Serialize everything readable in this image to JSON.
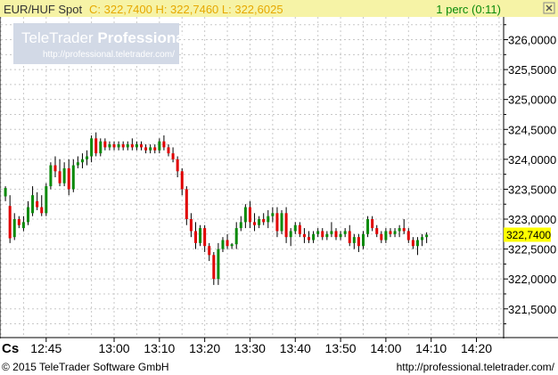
{
  "header": {
    "symbol": "EUR/HUF Spot",
    "quote": "C: 322,7400 H: 322,7460 L: 322,6025",
    "interval": "1 perc (0:11)"
  },
  "watermark": {
    "brand_light": "TeleTrader ",
    "brand_bold": "Professional",
    "url": "http://professional.teletrader.com/"
  },
  "footer": {
    "copyright": "© 2015 TeleTrader Software GmbH",
    "url": "http://professional.teletrader.com/"
  },
  "x_axis_corner": "Cs",
  "colors": {
    "up": "#0a8a0a",
    "down": "#e00000",
    "header_bg": "#f6f3a6",
    "last_price_badge": "#ffff00",
    "grid": "#c8c8c8"
  },
  "chart_data": {
    "type": "candlestick",
    "x_unit": "time (HH:MM)",
    "x_ticks": [
      "12:45",
      "13:00",
      "13:10",
      "13:20",
      "13:30",
      "13:40",
      "13:50",
      "14:00",
      "14:10",
      "14:20"
    ],
    "xlim": [
      "12:35",
      "14:26"
    ],
    "y_ticks": [
      "326,0000",
      "325,5000",
      "325,0000",
      "324,5000",
      "324,0000",
      "323,5000",
      "323,0000",
      "322,5000",
      "322,0000",
      "321,5000"
    ],
    "ylim": [
      321.02,
      326.38
    ],
    "last_price": 322.74,
    "last_price_label": "322,7400",
    "grid": true,
    "candles": [
      {
        "t": "12:36",
        "o": 323.38,
        "h": 323.55,
        "l": 323.3,
        "c": 323.52
      },
      {
        "t": "12:37",
        "o": 323.22,
        "h": 323.4,
        "l": 322.6,
        "c": 322.68
      },
      {
        "t": "12:38",
        "o": 322.7,
        "h": 323.1,
        "l": 322.65,
        "c": 323.0
      },
      {
        "t": "12:39",
        "o": 323.0,
        "h": 323.05,
        "l": 322.85,
        "c": 322.9
      },
      {
        "t": "12:40",
        "o": 322.85,
        "h": 323.05,
        "l": 322.8,
        "c": 322.95
      },
      {
        "t": "12:41",
        "o": 322.95,
        "h": 323.3,
        "l": 322.9,
        "c": 323.2
      },
      {
        "t": "12:42",
        "o": 323.1,
        "h": 323.55,
        "l": 323.05,
        "c": 323.4
      },
      {
        "t": "12:43",
        "o": 323.3,
        "h": 323.45,
        "l": 323.15,
        "c": 323.2
      },
      {
        "t": "12:44",
        "o": 323.2,
        "h": 323.4,
        "l": 323.05,
        "c": 323.1
      },
      {
        "t": "12:45",
        "o": 323.1,
        "h": 323.6,
        "l": 323.05,
        "c": 323.55
      },
      {
        "t": "12:46",
        "o": 323.55,
        "h": 323.95,
        "l": 323.5,
        "c": 323.9
      },
      {
        "t": "12:47",
        "o": 323.9,
        "h": 324.05,
        "l": 323.7,
        "c": 323.8
      },
      {
        "t": "12:48",
        "o": 323.8,
        "h": 324.0,
        "l": 323.55,
        "c": 323.6
      },
      {
        "t": "12:49",
        "o": 323.6,
        "h": 323.95,
        "l": 323.55,
        "c": 323.85
      },
      {
        "t": "12:50",
        "o": 323.85,
        "h": 324.0,
        "l": 323.4,
        "c": 323.5
      },
      {
        "t": "12:51",
        "o": 323.5,
        "h": 324.0,
        "l": 323.45,
        "c": 323.9
      },
      {
        "t": "12:52",
        "o": 323.9,
        "h": 324.05,
        "l": 323.85,
        "c": 323.95
      },
      {
        "t": "12:53",
        "o": 323.95,
        "h": 324.1,
        "l": 323.85,
        "c": 324.0
      },
      {
        "t": "12:54",
        "o": 324.0,
        "h": 324.15,
        "l": 323.9,
        "c": 324.05
      },
      {
        "t": "12:55",
        "o": 324.05,
        "h": 324.4,
        "l": 323.95,
        "c": 324.35
      },
      {
        "t": "12:56",
        "o": 324.35,
        "h": 324.45,
        "l": 324.05,
        "c": 324.1
      },
      {
        "t": "12:57",
        "o": 324.1,
        "h": 324.35,
        "l": 324.05,
        "c": 324.3
      },
      {
        "t": "12:58",
        "o": 324.3,
        "h": 324.35,
        "l": 324.15,
        "c": 324.2
      },
      {
        "t": "12:59",
        "o": 324.2,
        "h": 324.3,
        "l": 324.15,
        "c": 324.25
      },
      {
        "t": "13:00",
        "o": 324.25,
        "h": 324.3,
        "l": 324.15,
        "c": 324.2
      },
      {
        "t": "13:01",
        "o": 324.2,
        "h": 324.3,
        "l": 324.15,
        "c": 324.25
      },
      {
        "t": "13:02",
        "o": 324.25,
        "h": 324.3,
        "l": 324.15,
        "c": 324.2
      },
      {
        "t": "13:03",
        "o": 324.2,
        "h": 324.3,
        "l": 324.15,
        "c": 324.25
      },
      {
        "t": "13:04",
        "o": 324.25,
        "h": 324.35,
        "l": 324.15,
        "c": 324.2
      },
      {
        "t": "13:05",
        "o": 324.2,
        "h": 324.3,
        "l": 324.15,
        "c": 324.25
      },
      {
        "t": "13:06",
        "o": 324.25,
        "h": 324.3,
        "l": 324.15,
        "c": 324.2
      },
      {
        "t": "13:07",
        "o": 324.2,
        "h": 324.25,
        "l": 324.1,
        "c": 324.15
      },
      {
        "t": "13:08",
        "o": 324.15,
        "h": 324.25,
        "l": 324.1,
        "c": 324.2
      },
      {
        "t": "13:09",
        "o": 324.2,
        "h": 324.25,
        "l": 324.1,
        "c": 324.15
      },
      {
        "t": "13:10",
        "o": 324.15,
        "h": 324.35,
        "l": 324.1,
        "c": 324.3
      },
      {
        "t": "13:11",
        "o": 324.3,
        "h": 324.4,
        "l": 324.15,
        "c": 324.2
      },
      {
        "t": "13:12",
        "o": 324.2,
        "h": 324.25,
        "l": 324.05,
        "c": 324.1
      },
      {
        "t": "13:13",
        "o": 324.1,
        "h": 324.2,
        "l": 323.95,
        "c": 324.0
      },
      {
        "t": "13:14",
        "o": 324.0,
        "h": 324.05,
        "l": 323.7,
        "c": 323.8
      },
      {
        "t": "13:15",
        "o": 323.8,
        "h": 323.85,
        "l": 323.4,
        "c": 323.5
      },
      {
        "t": "13:16",
        "o": 323.5,
        "h": 323.55,
        "l": 322.9,
        "c": 323.0
      },
      {
        "t": "13:17",
        "o": 323.0,
        "h": 323.1,
        "l": 322.7,
        "c": 322.8
      },
      {
        "t": "13:18",
        "o": 322.8,
        "h": 322.95,
        "l": 322.5,
        "c": 322.6
      },
      {
        "t": "13:19",
        "o": 322.6,
        "h": 322.9,
        "l": 322.55,
        "c": 322.85
      },
      {
        "t": "13:20",
        "o": 322.85,
        "h": 322.9,
        "l": 322.45,
        "c": 322.55
      },
      {
        "t": "13:21",
        "o": 322.55,
        "h": 322.6,
        "l": 322.3,
        "c": 322.4
      },
      {
        "t": "13:22",
        "o": 322.4,
        "h": 322.45,
        "l": 321.9,
        "c": 322.0
      },
      {
        "t": "13:23",
        "o": 322.0,
        "h": 322.6,
        "l": 321.9,
        "c": 322.5
      },
      {
        "t": "13:24",
        "o": 322.5,
        "h": 322.7,
        "l": 322.45,
        "c": 322.65
      },
      {
        "t": "13:25",
        "o": 322.65,
        "h": 322.75,
        "l": 322.5,
        "c": 322.55
      },
      {
        "t": "13:26",
        "o": 322.55,
        "h": 322.6,
        "l": 322.5,
        "c": 322.58
      },
      {
        "t": "13:27",
        "o": 322.58,
        "h": 322.95,
        "l": 322.5,
        "c": 322.85
      },
      {
        "t": "13:28",
        "o": 322.85,
        "h": 323.05,
        "l": 322.8,
        "c": 322.95
      },
      {
        "t": "13:29",
        "o": 322.95,
        "h": 323.25,
        "l": 322.85,
        "c": 323.2
      },
      {
        "t": "13:30",
        "o": 323.2,
        "h": 323.3,
        "l": 322.85,
        "c": 322.95
      },
      {
        "t": "13:31",
        "o": 322.95,
        "h": 323.1,
        "l": 322.8,
        "c": 322.9
      },
      {
        "t": "13:32",
        "o": 322.9,
        "h": 323.05,
        "l": 322.85,
        "c": 323.0
      },
      {
        "t": "13:33",
        "o": 323.0,
        "h": 323.1,
        "l": 322.9,
        "c": 322.95
      },
      {
        "t": "13:34",
        "o": 322.95,
        "h": 323.15,
        "l": 322.85,
        "c": 323.05
      },
      {
        "t": "13:35",
        "o": 323.05,
        "h": 323.2,
        "l": 322.95,
        "c": 323.1
      },
      {
        "t": "13:36",
        "o": 323.1,
        "h": 323.2,
        "l": 322.7,
        "c": 322.8
      },
      {
        "t": "13:37",
        "o": 322.8,
        "h": 323.15,
        "l": 322.75,
        "c": 323.1
      },
      {
        "t": "13:38",
        "o": 323.1,
        "h": 323.2,
        "l": 322.6,
        "c": 322.7
      },
      {
        "t": "13:39",
        "o": 322.7,
        "h": 322.85,
        "l": 322.55,
        "c": 322.8
      },
      {
        "t": "13:40",
        "o": 322.8,
        "h": 322.95,
        "l": 322.75,
        "c": 322.9
      },
      {
        "t": "13:41",
        "o": 322.9,
        "h": 322.95,
        "l": 322.7,
        "c": 322.75
      },
      {
        "t": "13:42",
        "o": 322.75,
        "h": 322.85,
        "l": 322.6,
        "c": 322.7
      },
      {
        "t": "13:43",
        "o": 322.7,
        "h": 322.8,
        "l": 322.6,
        "c": 322.65
      },
      {
        "t": "13:44",
        "o": 322.65,
        "h": 322.8,
        "l": 322.6,
        "c": 322.75
      },
      {
        "t": "13:45",
        "o": 322.75,
        "h": 322.85,
        "l": 322.7,
        "c": 322.8
      },
      {
        "t": "13:46",
        "o": 322.8,
        "h": 322.85,
        "l": 322.65,
        "c": 322.7
      },
      {
        "t": "13:47",
        "o": 322.7,
        "h": 322.8,
        "l": 322.65,
        "c": 322.75
      },
      {
        "t": "13:48",
        "o": 322.75,
        "h": 322.95,
        "l": 322.7,
        "c": 322.8
      },
      {
        "t": "13:49",
        "o": 322.8,
        "h": 322.85,
        "l": 322.65,
        "c": 322.7
      },
      {
        "t": "13:50",
        "o": 322.7,
        "h": 322.8,
        "l": 322.65,
        "c": 322.75
      },
      {
        "t": "13:51",
        "o": 322.75,
        "h": 322.85,
        "l": 322.7,
        "c": 322.8
      },
      {
        "t": "13:52",
        "o": 322.8,
        "h": 322.9,
        "l": 322.55,
        "c": 322.6
      },
      {
        "t": "13:53",
        "o": 322.6,
        "h": 322.75,
        "l": 322.5,
        "c": 322.7
      },
      {
        "t": "13:54",
        "o": 322.7,
        "h": 322.75,
        "l": 322.45,
        "c": 322.55
      },
      {
        "t": "13:55",
        "o": 322.55,
        "h": 322.8,
        "l": 322.5,
        "c": 322.75
      },
      {
        "t": "13:56",
        "o": 322.75,
        "h": 323.05,
        "l": 322.7,
        "c": 323.0
      },
      {
        "t": "13:57",
        "o": 323.0,
        "h": 323.05,
        "l": 322.8,
        "c": 322.85
      },
      {
        "t": "13:58",
        "o": 322.85,
        "h": 322.9,
        "l": 322.7,
        "c": 322.75
      },
      {
        "t": "13:59",
        "o": 322.75,
        "h": 322.8,
        "l": 322.6,
        "c": 322.65
      },
      {
        "t": "14:00",
        "o": 322.65,
        "h": 322.85,
        "l": 322.6,
        "c": 322.8
      },
      {
        "t": "14:01",
        "o": 322.8,
        "h": 322.85,
        "l": 322.7,
        "c": 322.75
      },
      {
        "t": "14:02",
        "o": 322.75,
        "h": 322.85,
        "l": 322.7,
        "c": 322.8
      },
      {
        "t": "14:03",
        "o": 322.8,
        "h": 322.9,
        "l": 322.7,
        "c": 322.85
      },
      {
        "t": "14:04",
        "o": 322.85,
        "h": 323.0,
        "l": 322.75,
        "c": 322.8
      },
      {
        "t": "14:05",
        "o": 322.8,
        "h": 322.85,
        "l": 322.6,
        "c": 322.65
      },
      {
        "t": "14:06",
        "o": 322.65,
        "h": 322.7,
        "l": 322.5,
        "c": 322.55
      },
      {
        "t": "14:07",
        "o": 322.55,
        "h": 322.7,
        "l": 322.4,
        "c": 322.65
      },
      {
        "t": "14:08",
        "o": 322.65,
        "h": 322.75,
        "l": 322.55,
        "c": 322.7
      },
      {
        "t": "14:09",
        "o": 322.7,
        "h": 322.78,
        "l": 322.6,
        "c": 322.74
      }
    ]
  }
}
